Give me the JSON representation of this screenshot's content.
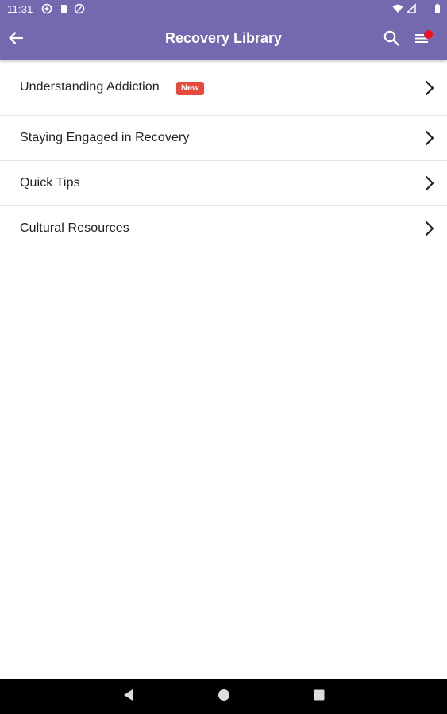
{
  "status_bar": {
    "time": "11:31",
    "icons": [
      "notification-icon",
      "sd-card-icon",
      "notification-icon",
      "wifi-icon",
      "signal-icon",
      "battery-icon"
    ]
  },
  "app_bar": {
    "title": "Recovery Library",
    "back_icon": "arrow-left-icon",
    "search_icon": "search-icon",
    "menu_icon": "menu-icon",
    "has_notification_dot": true
  },
  "list": {
    "items": [
      {
        "label": "Understanding Addiction",
        "badge": "New"
      },
      {
        "label": "Staying Engaged in Recovery"
      },
      {
        "label": "Quick Tips"
      },
      {
        "label": "Cultural Resources"
      }
    ]
  },
  "nav_bar": {
    "buttons": [
      "back-triangle-icon",
      "home-circle-icon",
      "recents-square-icon"
    ]
  },
  "colors": {
    "app_bar": "#7468ae",
    "badge": "#e74a3c",
    "notification_dot": "#e8141c",
    "text": "#222222",
    "divider": "#e3e3e3",
    "nav_bar": "#000000"
  }
}
